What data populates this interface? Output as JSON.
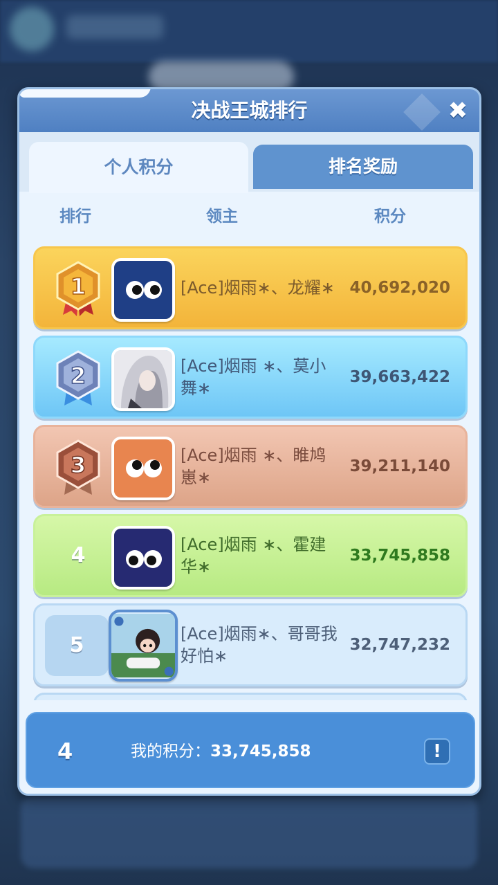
{
  "dialog": {
    "title": "决战王城排行",
    "close_icon": "✖"
  },
  "tabs": [
    {
      "label": "个人积分",
      "active": true
    },
    {
      "label": "排名奖励",
      "active": false
    }
  ],
  "columns": {
    "rank": "排行",
    "lord": "领主",
    "score": "积分"
  },
  "rows": [
    {
      "rank": "1",
      "rank_style": "gold-medal-icon",
      "name_lines": [
        "[Ace]烟雨∗、龙耀∗"
      ],
      "score": "40,692,020",
      "avatar": "eyes-avatar-navy"
    },
    {
      "rank": "2",
      "rank_style": "silver-medal-icon",
      "name_lines": [
        "[Ace]烟雨 ∗、莫小",
        "舞∗"
      ],
      "score": "39,663,422",
      "avatar": "anime-girl-avatar"
    },
    {
      "rank": "3",
      "rank_style": "bronze-medal-icon",
      "name_lines": [
        "[Ace]烟雨 ∗、睢鸠",
        "崽∗"
      ],
      "score": "39,211,140",
      "avatar": "eyes-avatar-orange"
    },
    {
      "rank": "4",
      "rank_style": "plain",
      "name_lines": [
        "[Ace]烟雨 ∗、霍建",
        "华∗"
      ],
      "score": "33,745,858",
      "avatar": "eyes-avatar-indigo"
    },
    {
      "rank": "5",
      "rank_style": "box",
      "name_lines": [
        "[Ace]烟雨∗、哥哥我",
        "好怕∗"
      ],
      "score": "32,747,232",
      "avatar": "cartoon-avatar-framed"
    }
  ],
  "footer": {
    "my_rank": "4",
    "label": "我的积分：",
    "my_score": "33,745,858",
    "info_icon": "!"
  },
  "colors": {
    "header": "#4f80c2",
    "gold": "#f3b43a",
    "silver": "#6ec6f6",
    "bronze": "#dda488",
    "green": "#b7ea82",
    "footer": "#4a8fd9"
  }
}
